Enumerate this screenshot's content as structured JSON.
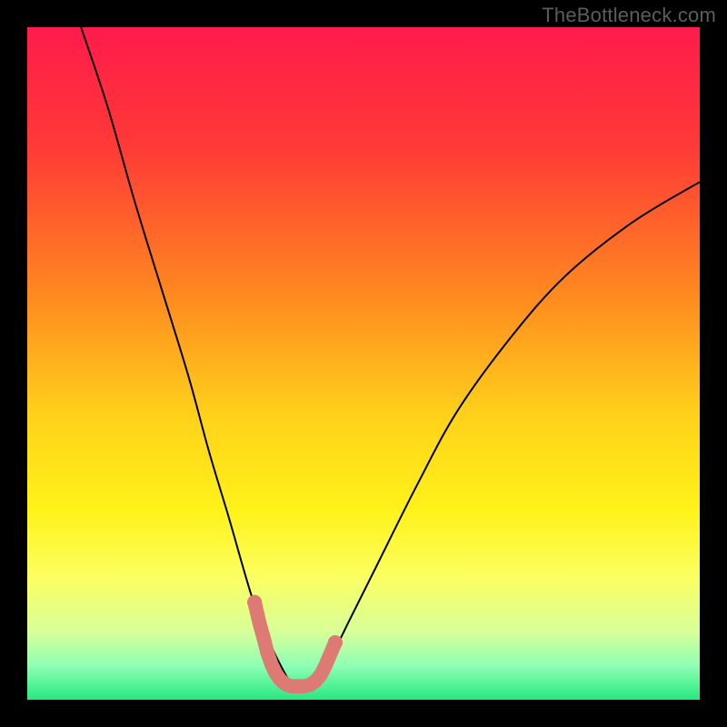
{
  "watermark": "TheBottleneck.com",
  "chart_data": {
    "type": "line",
    "title": "",
    "xlabel": "",
    "ylabel": "",
    "xlim": [
      0,
      100
    ],
    "ylim": [
      0,
      100
    ],
    "background": {
      "type": "vertical_gradient",
      "stops": [
        {
          "pos": 0.0,
          "color": "#ff1b4b"
        },
        {
          "pos": 0.18,
          "color": "#ff3a37"
        },
        {
          "pos": 0.4,
          "color": "#ff8a1f"
        },
        {
          "pos": 0.58,
          "color": "#ffd21a"
        },
        {
          "pos": 0.72,
          "color": "#fff31a"
        },
        {
          "pos": 0.82,
          "color": "#fbff63"
        },
        {
          "pos": 0.9,
          "color": "#d7ff9a"
        },
        {
          "pos": 0.95,
          "color": "#8dffb5"
        },
        {
          "pos": 1.0,
          "color": "#27e87f"
        }
      ]
    },
    "series": [
      {
        "name": "bottleneck-curve",
        "color": "#000000",
        "stroke_width": 2,
        "x": [
          8,
          12,
          16,
          20,
          24,
          27,
          30,
          32,
          33.5,
          35,
          36.5,
          38,
          39,
          40,
          41,
          42,
          43,
          45,
          48,
          52,
          58,
          64,
          72,
          80,
          90,
          100
        ],
        "values": [
          100,
          88,
          74,
          61,
          48,
          37,
          27,
          20,
          15,
          11,
          7.5,
          4.5,
          2.8,
          2.0,
          2.0,
          2.3,
          3.2,
          6,
          12,
          20,
          32,
          43,
          54,
          63,
          71,
          77
        ]
      }
    ],
    "markers": {
      "name": "highlight-near-minimum",
      "color": "#dd7a73",
      "radius": 6,
      "points": [
        {
          "x": 33.8,
          "y": 14.5
        },
        {
          "x": 34.5,
          "y": 11.5
        },
        {
          "x": 35.2,
          "y": 9.0
        },
        {
          "x": 35.7,
          "y": 7.0
        },
        {
          "x": 36.3,
          "y": 5.3
        },
        {
          "x": 36.9,
          "y": 4.0
        },
        {
          "x": 37.6,
          "y": 3.0
        },
        {
          "x": 38.4,
          "y": 2.3
        },
        {
          "x": 39.3,
          "y": 2.0
        },
        {
          "x": 40.2,
          "y": 2.0
        },
        {
          "x": 41.1,
          "y": 2.0
        },
        {
          "x": 42.0,
          "y": 2.2
        },
        {
          "x": 42.9,
          "y": 2.8
        },
        {
          "x": 43.7,
          "y": 3.8
        },
        {
          "x": 44.3,
          "y": 5.0
        },
        {
          "x": 45.8,
          "y": 8.5
        }
      ]
    }
  }
}
